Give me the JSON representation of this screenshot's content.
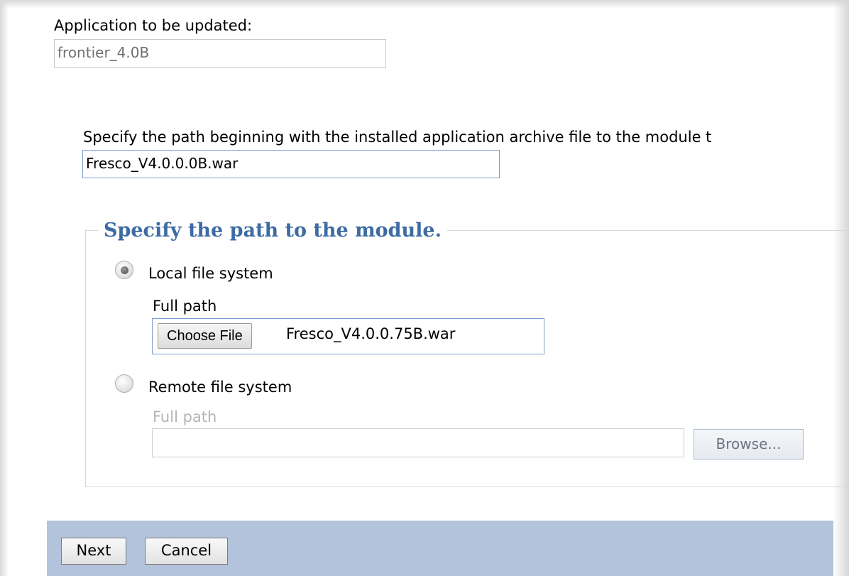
{
  "update": {
    "app_label": "Application to be updated:",
    "app_value": "frontier_4.0B",
    "path_instruction": "Specify the path beginning with the installed application archive file to the module t",
    "path_value": "Fresco_V4.0.0.0B.war"
  },
  "module": {
    "legend": "Specify the path to the module.",
    "local": {
      "label": "Local file system",
      "selected": true,
      "full_path_label": "Full path",
      "choose_button": "Choose File",
      "chosen_file": "Fresco_V4.0.0.75B.war"
    },
    "remote": {
      "label": "Remote file system",
      "selected": false,
      "full_path_label": "Full path",
      "value": "",
      "browse_button": "Browse..."
    }
  },
  "footer": {
    "next_label": "Next",
    "cancel_label": "Cancel"
  },
  "colors": {
    "legend": "#3d6ba3",
    "footer": "#b3c3db",
    "disabled_text": "#b5b5b5"
  }
}
